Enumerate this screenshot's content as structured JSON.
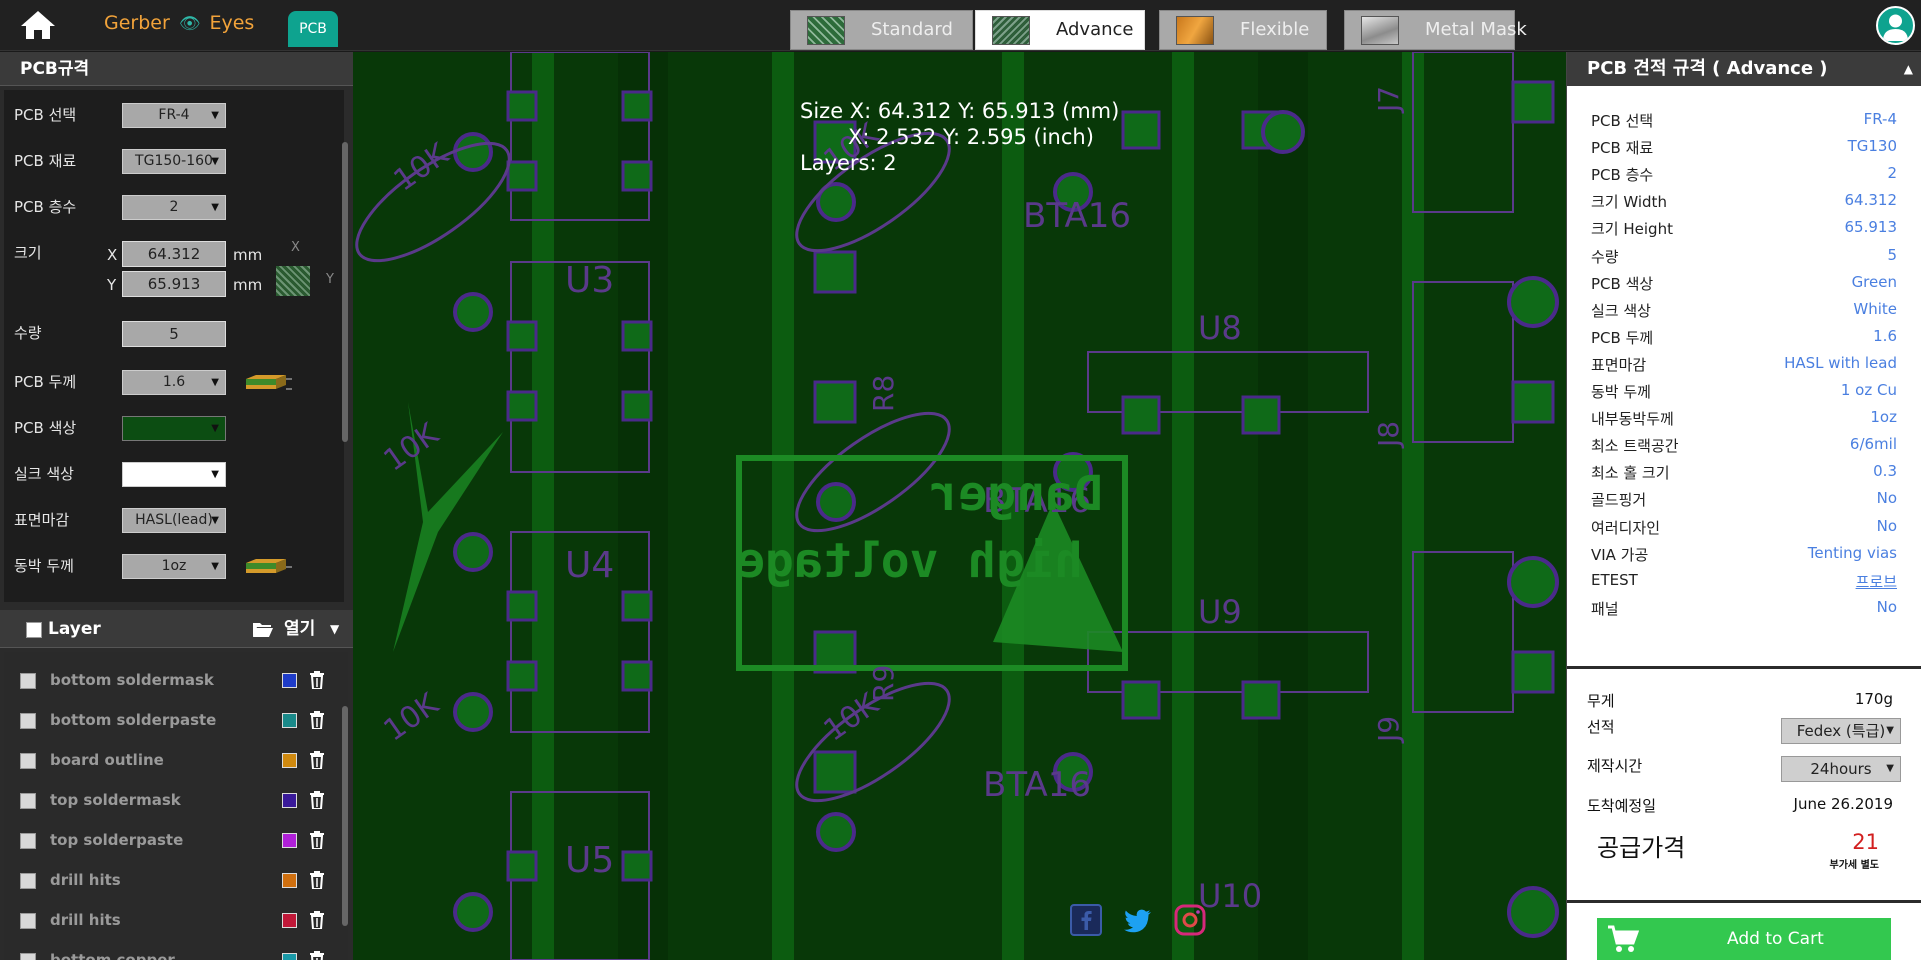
{
  "topbar": {
    "brand_left": "Gerber",
    "brand_right": "Eyes",
    "pcb_chip": "PCB",
    "tabs": [
      {
        "label": "Standard"
      },
      {
        "label": "Advance"
      },
      {
        "label": "Flexible"
      },
      {
        "label": "Metal Mask"
      }
    ],
    "active_tab": "Advance"
  },
  "spec_panel": {
    "title": "PCB규격",
    "rows": {
      "pcb_select": {
        "label": "PCB 선택",
        "value": "FR-4"
      },
      "pcb_material": {
        "label": "PCB 재료",
        "value": "TG150-160"
      },
      "pcb_layers": {
        "label": "PCB 층수",
        "value": "2"
      },
      "size": {
        "label": "크기",
        "x_label": "X",
        "y_label": "Y",
        "x_value": "64.312",
        "y_value": "65.913",
        "unit": "mm",
        "preview_x": "X",
        "preview_y": "Y"
      },
      "quantity": {
        "label": "수량",
        "value": "5"
      },
      "thickness": {
        "label": "PCB 두께",
        "value": "1.6"
      },
      "pcb_color": {
        "label": "PCB 색상",
        "value": ""
      },
      "silk_color": {
        "label": "실크 색상",
        "value": ""
      },
      "finish": {
        "label": "표면마감",
        "value": "HASL(lead)"
      },
      "copper": {
        "label": "동박 두께",
        "value": "1oz"
      }
    }
  },
  "layer_panel": {
    "title": "Layer",
    "open_label": "열기",
    "layers": [
      {
        "name": "bottom soldermask",
        "color": "#1e3cc8"
      },
      {
        "name": "bottom solderpaste",
        "color": "#1a8a8a"
      },
      {
        "name": "board outline",
        "color": "#d08a10"
      },
      {
        "name": "top soldermask",
        "color": "#3a1a9a"
      },
      {
        "name": "top solderpaste",
        "color": "#b020d8"
      },
      {
        "name": "drill hits",
        "color": "#d07010"
      },
      {
        "name": "drill hits",
        "color": "#c01838"
      },
      {
        "name": "bottom copper",
        "color": "#1a9aa8"
      }
    ]
  },
  "canvas": {
    "size_mm": "Size X: 64.312 Y: 65.913 (mm)",
    "size_inch": "X: 2.532 Y: 2.595 (inch)",
    "layers": "Layers: 2",
    "board_text": {
      "danger": "Danger",
      "voltage": "high voltage",
      "bta_1": "BTA16",
      "bta_2": "BTA16",
      "bta_3": "BTA16",
      "u3": "U3",
      "u4": "U4",
      "u5": "U5",
      "u8": "U8",
      "u9": "U9",
      "u10": "U10",
      "r8": "R8",
      "r9": "R9",
      "k1": "10K",
      "k2": "10K",
      "k3": "10K",
      "k4": "10K",
      "k5": "10K",
      "j7": "J7",
      "j8": "J8",
      "j9": "J9"
    },
    "social": [
      "facebook-icon",
      "twitter-icon",
      "instagram-icon"
    ]
  },
  "estimate": {
    "title": "PCB 견적 규격 ( Advance )",
    "rows": [
      {
        "k": "PCB 선택",
        "v": "FR-4"
      },
      {
        "k": "PCB 재료",
        "v": "TG130"
      },
      {
        "k": "PCB 층수",
        "v": "2"
      },
      {
        "k": "크기 Width",
        "v": "64.312"
      },
      {
        "k": "크기 Height",
        "v": "65.913"
      },
      {
        "k": "수량",
        "v": "5"
      },
      {
        "k": "PCB 색상",
        "v": "Green"
      },
      {
        "k": "실크 색상",
        "v": "White"
      },
      {
        "k": "PCB 두께",
        "v": "1.6"
      },
      {
        "k": "표면마감",
        "v": "HASL with lead"
      },
      {
        "k": "동박 두께",
        "v": "1 oz Cu"
      },
      {
        "k": "내부동박두께",
        "v": "1oz"
      },
      {
        "k": "최소 트랙공간",
        "v": "6/6mil"
      },
      {
        "k": "최소 홀 크기",
        "v": "0.3"
      },
      {
        "k": "골드핑거",
        "v": "No"
      },
      {
        "k": "여러디자인",
        "v": "No"
      },
      {
        "k": "VIA 가공",
        "v": "Tenting vias"
      },
      {
        "k": "ETEST",
        "v": "프로브"
      },
      {
        "k": "패널",
        "v": "No"
      }
    ],
    "weight_label": "무게",
    "weight_value": "170g",
    "shipping_label": "선적",
    "shipping_value": "Fedex (특급)",
    "lead_label": "제작시간",
    "lead_value": "24hours",
    "arrival_label": "도착예정일",
    "arrival_value": "June 26.2019",
    "price_label": "공급가격",
    "price_value": "21",
    "vat_note": "부가세 별도",
    "cart_label": "Add to Cart"
  }
}
